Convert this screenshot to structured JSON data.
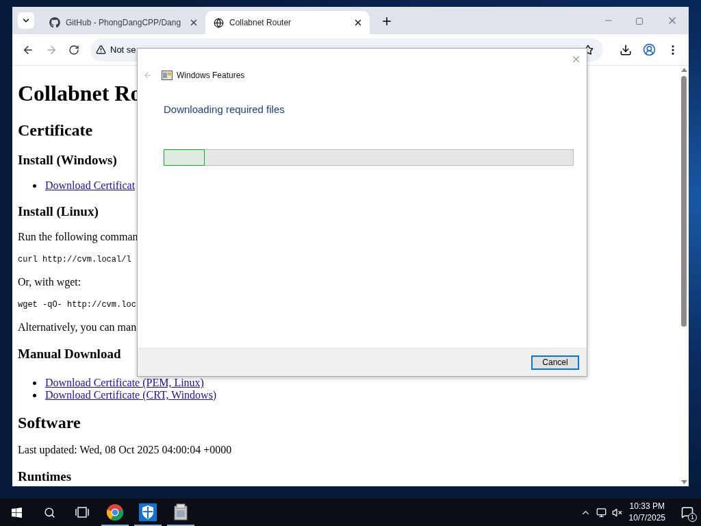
{
  "browser": {
    "tabs": [
      {
        "title": "GitHub - PhongDangCPP/Dang",
        "kind": "github",
        "selected": false
      },
      {
        "title": "Collabnet Router",
        "kind": "globe",
        "selected": true
      }
    ],
    "security_chip": "Not se",
    "page": [
      {
        "kind": "h1",
        "text": "Collabnet Ro"
      },
      {
        "kind": "h2",
        "text": "Certificate"
      },
      {
        "kind": "h3",
        "text": "Install (Windows)"
      },
      {
        "kind": "link",
        "text": "Download Certificat"
      },
      {
        "kind": "h3",
        "text": "Install (Linux)"
      },
      {
        "kind": "p",
        "text": "Run the following comman"
      },
      {
        "kind": "code",
        "text": "curl http://cvm.local/l"
      },
      {
        "kind": "p",
        "text": "Or, with wget:"
      },
      {
        "kind": "code",
        "text": "wget -qO- http://cvm.loc"
      },
      {
        "kind": "p",
        "text": "Alternatively, you can man"
      },
      {
        "kind": "h3",
        "text": "Manual Download"
      },
      {
        "kind": "link",
        "text": "Download Certificate (PEM, Linux)"
      },
      {
        "kind": "link",
        "text": "Download Certificate (CRT, Windows)"
      },
      {
        "kind": "h2",
        "text": "Software"
      },
      {
        "kind": "p",
        "text": "Last updated: Wed, 08 Oct 2025 04:00:04 +0000"
      },
      {
        "kind": "h3",
        "text": "Runtimes"
      }
    ]
  },
  "dialog": {
    "title": "Windows Features",
    "heading": "Downloading required files",
    "progress": {
      "level": 0.1
    },
    "buttons": [
      "Cancel"
    ]
  },
  "taskbar": {
    "apps": [
      {
        "kind": "chrome",
        "running": true
      },
      {
        "kind": "shield",
        "running": true
      },
      {
        "kind": "installer",
        "running": true
      }
    ],
    "time": "10:33 PM",
    "date": "10/7/2025",
    "notification_count": "1"
  }
}
